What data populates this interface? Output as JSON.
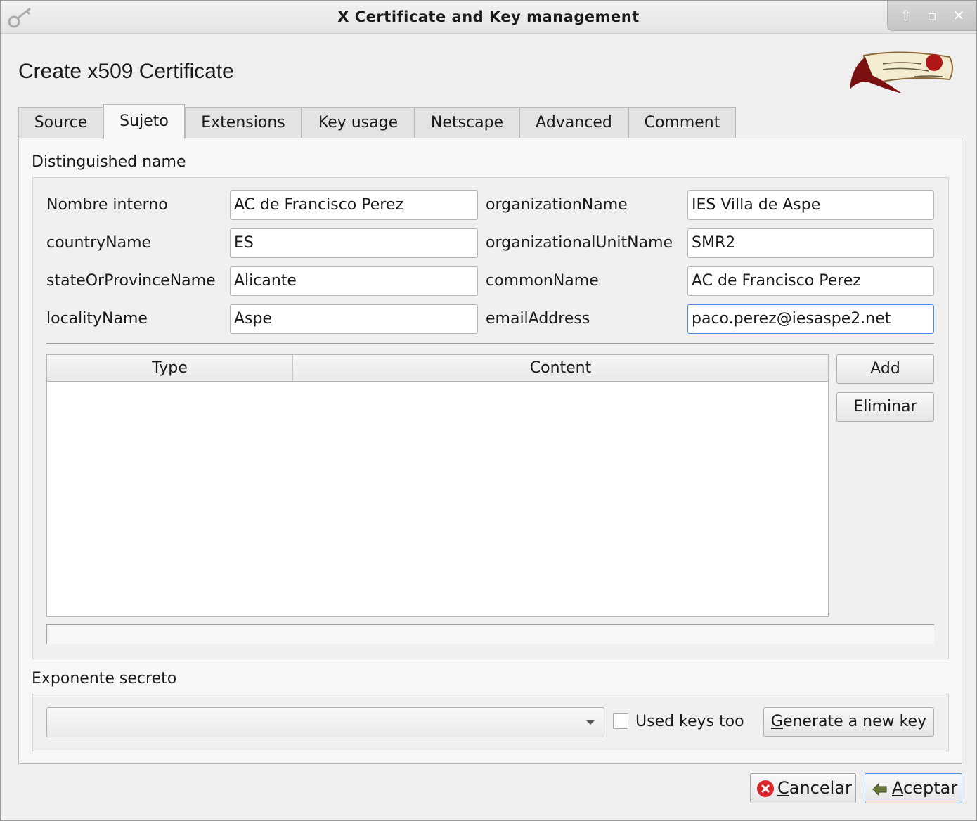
{
  "window": {
    "title": "X Certificate and Key management",
    "wm_buttons": [
      "shade-icon",
      "maximize-icon",
      "close-icon"
    ]
  },
  "dialog": {
    "heading": "Create x509 Certificate",
    "logo_icon": "certificate-scroll-logo"
  },
  "tabs": [
    {
      "label": "Source",
      "active": false
    },
    {
      "label": "Sujeto",
      "active": true
    },
    {
      "label": "Extensions",
      "active": false
    },
    {
      "label": "Key usage",
      "active": false
    },
    {
      "label": "Netscape",
      "active": false
    },
    {
      "label": "Advanced",
      "active": false
    },
    {
      "label": "Comment",
      "active": false
    }
  ],
  "distinguished_name": {
    "group_label": "Distinguished name",
    "fields": [
      {
        "label": "Nombre interno",
        "value": "AC de Francisco Perez"
      },
      {
        "label": "countryName",
        "value": "ES"
      },
      {
        "label": "stateOrProvinceName",
        "value": "Alicante"
      },
      {
        "label": "localityName",
        "value": "Aspe"
      },
      {
        "label": "organizationName",
        "value": "IES Villa de Aspe"
      },
      {
        "label": "organizationalUnitName",
        "value": "SMR2"
      },
      {
        "label": "commonName",
        "value": "AC de Francisco Perez"
      },
      {
        "label": "emailAddress",
        "value": "paco.perez@iesaspe2.net"
      }
    ],
    "table": {
      "columns": [
        "Type",
        "Content"
      ],
      "rows": []
    },
    "add_button": "Add",
    "remove_button": "Eliminar"
  },
  "private_key": {
    "group_label": "Exponente secreto",
    "combo_value": "",
    "used_keys_label": "Used keys too",
    "used_keys_checked": false,
    "generate_button": "Generate a new key"
  },
  "footer": {
    "cancel_button": "Cancelar",
    "ok_button": "Aceptar",
    "colors": {
      "cancel_icon": "#d9252a",
      "ok_icon": "#6b7a3a",
      "focus": "#4a8fd8"
    }
  }
}
